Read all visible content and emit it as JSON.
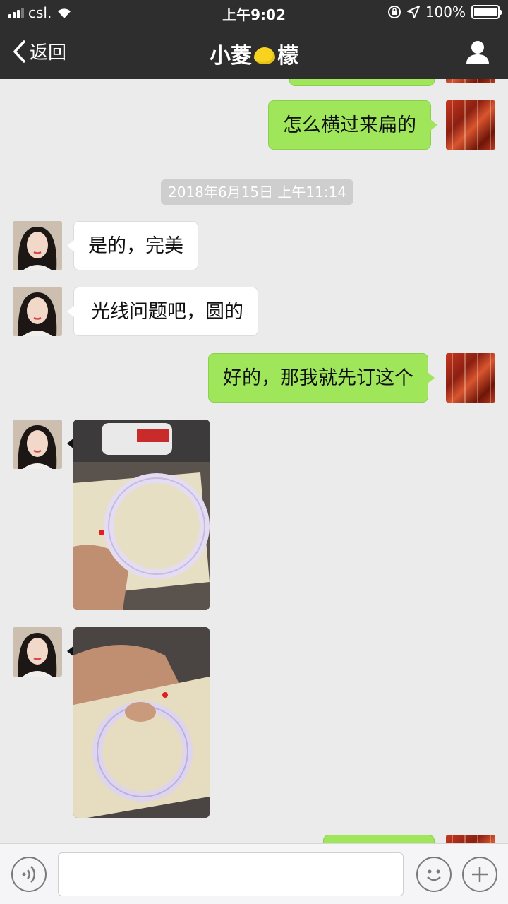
{
  "status_bar": {
    "carrier": "csl.",
    "time": "上午9:02",
    "battery": "100%"
  },
  "nav": {
    "back_label": "返回",
    "title_part1": "小菱",
    "title_part2": "檬"
  },
  "messages": {
    "m1": "怎么横过来扁的",
    "timestamp": "2018年6月15日 上午11:14",
    "m2": "是的，完美",
    "m3": "光线问题吧，圆的",
    "m4": "好的，那我就先订这个"
  },
  "input": {
    "value": ""
  },
  "colors": {
    "nav_bg": "#2e2e2e",
    "chat_bg": "#ebebeb",
    "my_bubble": "#9fe65a",
    "their_bubble": "#ffffff"
  },
  "icons": [
    "back-chevron-icon",
    "lemon-emoji-icon",
    "contact-profile-icon",
    "voice-icon",
    "emoji-icon",
    "plus-icon",
    "wifi-icon",
    "location-arrow-icon",
    "rotation-lock-icon"
  ]
}
